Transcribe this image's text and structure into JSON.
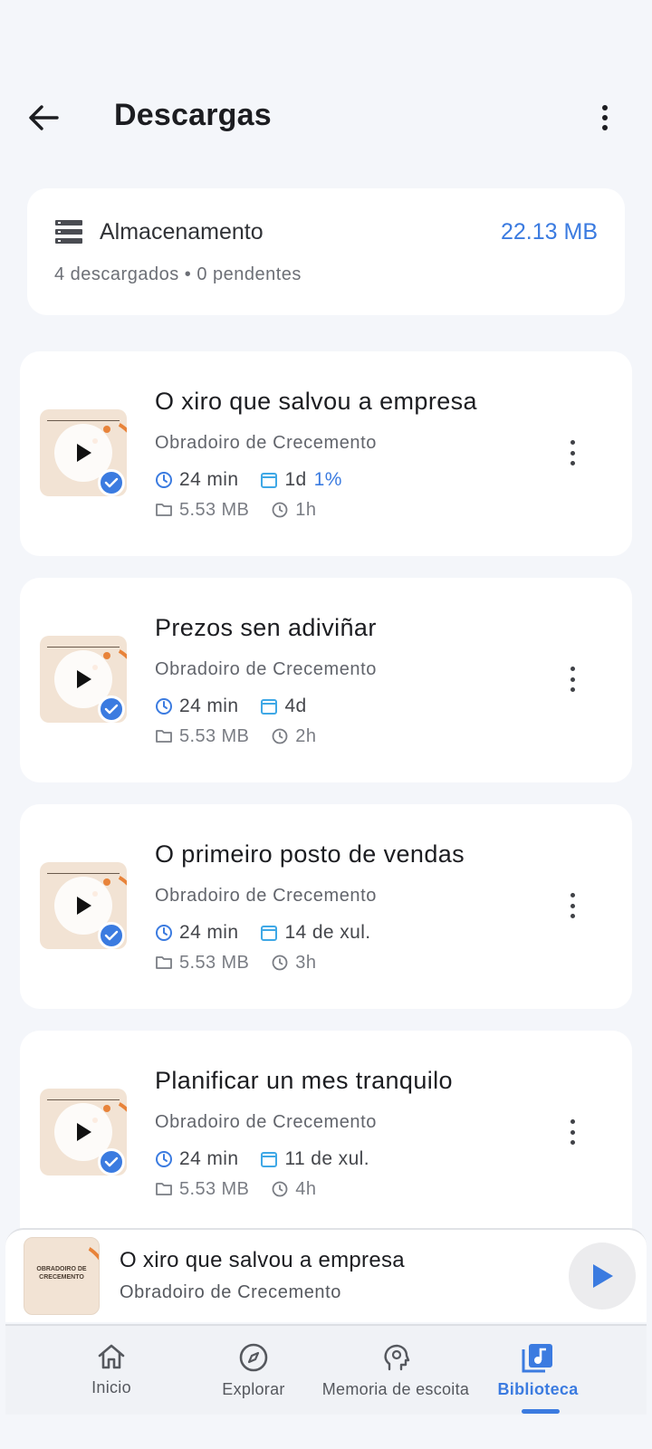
{
  "header": {
    "title": "Descargas",
    "back_icon": "arrow-left-icon",
    "menu_icon": "more-vert-icon"
  },
  "storage": {
    "label": "Almacenamento",
    "size": "22.13 MB",
    "summary": "4 descargados • 0 pendentes",
    "icon": "storage-icon"
  },
  "episodes": [
    {
      "title": "O xiro que salvou a empresa",
      "author": "Obradoiro de Crecemento",
      "duration": "24 min",
      "date": "1d",
      "progress": "1%",
      "size": "5.53 MB",
      "downloaded_ago": "1h"
    },
    {
      "title": "Prezos sen adiviñar",
      "author": "Obradoiro de Crecemento",
      "duration": "24 min",
      "date": "4d",
      "progress": "",
      "size": "5.53 MB",
      "downloaded_ago": "2h"
    },
    {
      "title": "O primeiro posto de vendas",
      "author": "Obradoiro de Crecemento",
      "duration": "24 min",
      "date": "14 de xul.",
      "progress": "",
      "size": "5.53 MB",
      "downloaded_ago": "3h"
    },
    {
      "title": "Planificar un mes tranquilo",
      "author": "Obradoiro de Crecemento",
      "duration": "24 min",
      "date": "11 de xul.",
      "progress": "",
      "size": "5.53 MB",
      "downloaded_ago": "4h"
    }
  ],
  "player": {
    "title": "O xiro que salvou a empresa",
    "author": "Obradoiro de Crecemento",
    "cover_text": "OBRADOIRO DE CRECEMENTO"
  },
  "nav": {
    "items": [
      {
        "label": "Inicio",
        "icon": "home-icon"
      },
      {
        "label": "Explorar",
        "icon": "compass-icon"
      },
      {
        "label": "Memoria de escoita",
        "icon": "head-gear-icon"
      },
      {
        "label": "Biblioteca",
        "icon": "library-music-icon"
      }
    ],
    "active": "Biblioteca"
  },
  "colors": {
    "accent": "#3b7be0",
    "background": "#f4f6fa",
    "card": "#ffffff",
    "cover": "#f2e3d4",
    "cover_accent": "#e8833a"
  }
}
